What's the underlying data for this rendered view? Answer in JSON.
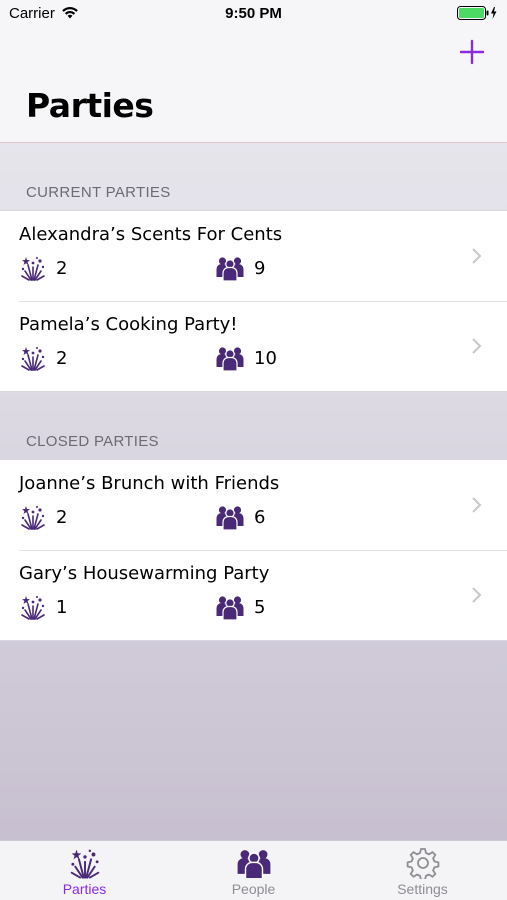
{
  "status_bar": {
    "carrier": "Carrier",
    "time": "9:50 PM"
  },
  "header": {
    "title": "Parties"
  },
  "sections": [
    {
      "header": "CURRENT PARTIES",
      "items": [
        {
          "title": "Alexandra’s Scents For Cents",
          "parties": "2",
          "people": "9"
        },
        {
          "title": "Pamela’s Cooking Party!",
          "parties": "2",
          "people": "10"
        }
      ]
    },
    {
      "header": "CLOSED PARTIES",
      "items": [
        {
          "title": "Joanne’s Brunch with Friends",
          "parties": "2",
          "people": "6"
        },
        {
          "title": "Gary’s Housewarming Party",
          "parties": "1",
          "people": "5"
        }
      ]
    }
  ],
  "tabs": [
    {
      "label": "Parties",
      "icon": "fireworks-icon",
      "active": true
    },
    {
      "label": "People",
      "icon": "people-icon",
      "active": false
    },
    {
      "label": "Settings",
      "icon": "gear-icon",
      "active": false
    }
  ],
  "colors": {
    "accent": "#8a2be2",
    "icon_purple": "#4a2a78",
    "inactive": "#8e8e93"
  }
}
